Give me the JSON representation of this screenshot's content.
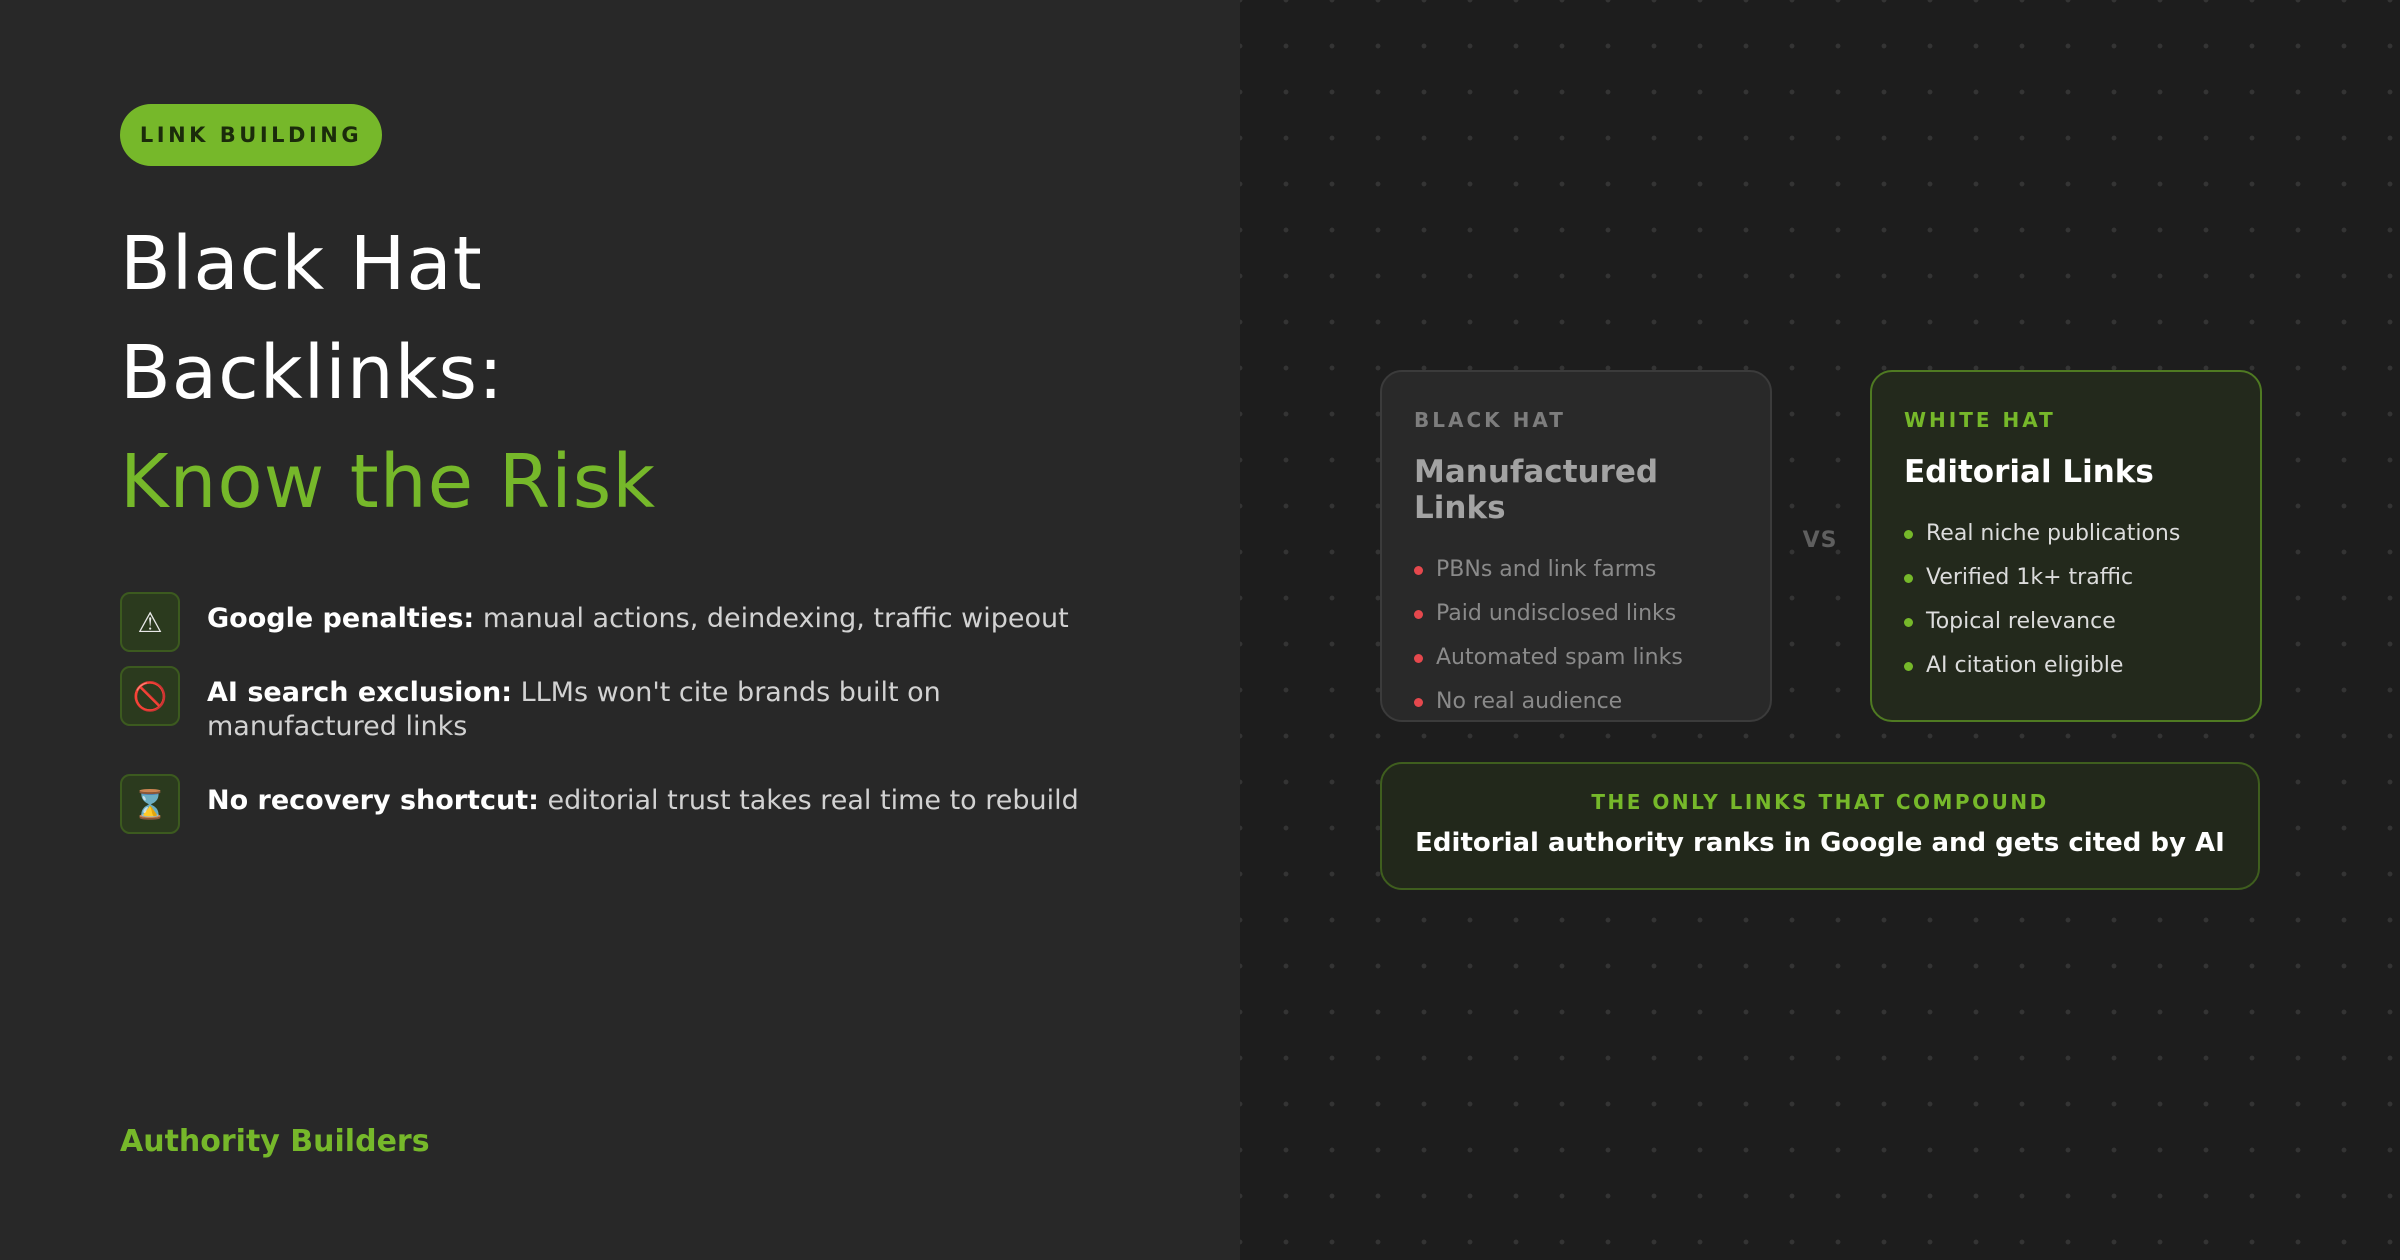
{
  "tag": "LINK BUILDING",
  "title": {
    "line1": "Black Hat",
    "line2": "Backlinks:",
    "line3": "Know the Risk"
  },
  "risks": [
    {
      "icon": "warning-icon",
      "glyph": "⚠",
      "label": "Google penalties:",
      "text": "manual actions, deindexing, traffic wipeout"
    },
    {
      "icon": "prohibited-icon",
      "glyph": "🚫",
      "label": "AI search exclusion:",
      "text": "LLMs won't cite brands built on manufactured links"
    },
    {
      "icon": "hourglass-icon",
      "glyph": "⌛",
      "label": "No recovery shortcut:",
      "text": "editorial trust takes real time to rebuild"
    }
  ],
  "brand": "Authority Builders",
  "black_card": {
    "kicker": "BLACK HAT",
    "title": "Manufactured Links",
    "items": [
      "PBNs and link farms",
      "Paid undisclosed links",
      "Automated spam links",
      "No real audience"
    ]
  },
  "vs": "VS",
  "white_card": {
    "kicker": "WHITE HAT",
    "title": "Editorial Links",
    "items": [
      "Real niche publications",
      "Verified 1k+ traffic",
      "Topical relevance",
      "AI citation eligible"
    ]
  },
  "banner": {
    "kicker": "THE ONLY LINKS THAT COMPOUND",
    "text": "Editorial authority ranks in Google and gets cited by AI"
  },
  "colors": {
    "accent": "#76b82a",
    "bad": "#e5484d",
    "left_bg": "#282828",
    "right_bg": "#1d1d1d"
  }
}
